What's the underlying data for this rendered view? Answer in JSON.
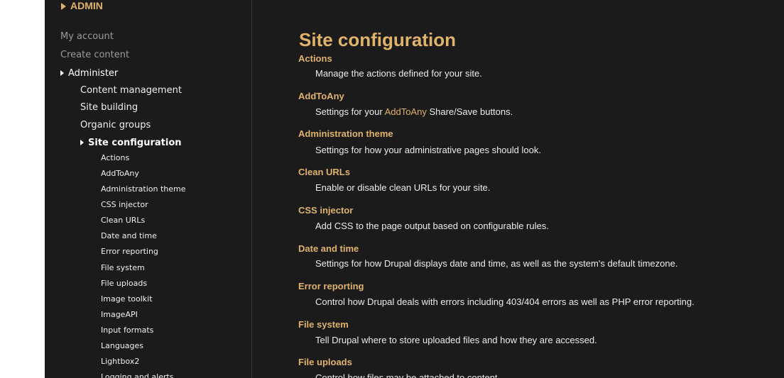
{
  "sidebar": {
    "section_title": "ADMIN",
    "top_items": [
      {
        "label": "My account"
      },
      {
        "label": "Create content"
      }
    ],
    "administer_label": "Administer",
    "admin_items": [
      {
        "label": "Content management"
      },
      {
        "label": "Site building"
      },
      {
        "label": "Organic groups"
      }
    ],
    "site_config_label": "Site configuration",
    "site_config_items": [
      {
        "label": "Actions"
      },
      {
        "label": "AddToAny"
      },
      {
        "label": "Administration theme"
      },
      {
        "label": "CSS injector"
      },
      {
        "label": "Clean URLs"
      },
      {
        "label": "Date and time"
      },
      {
        "label": "Error reporting"
      },
      {
        "label": "File system"
      },
      {
        "label": "File uploads"
      },
      {
        "label": "Image toolkit"
      },
      {
        "label": "ImageAPI"
      },
      {
        "label": "Input formats"
      },
      {
        "label": "Languages"
      },
      {
        "label": "Lightbox2"
      },
      {
        "label": "Logging and alerts"
      }
    ]
  },
  "main": {
    "page_title": "Site configuration",
    "entries": [
      {
        "title": "Actions",
        "desc": "Manage the actions defined for your site."
      },
      {
        "title": "AddToAny",
        "desc_pre": "Settings for your ",
        "desc_link": "AddToAny",
        "desc_post": " Share/Save buttons."
      },
      {
        "title": "Administration theme",
        "desc": "Settings for how your administrative pages should look."
      },
      {
        "title": "Clean URLs",
        "desc": "Enable or disable clean URLs for your site."
      },
      {
        "title": "CSS injector",
        "desc": "Add CSS to the page output based on configurable rules."
      },
      {
        "title": "Date and time",
        "desc": "Settings for how Drupal displays date and time, as well as the system's default timezone."
      },
      {
        "title": "Error reporting",
        "desc": "Control how Drupal deals with errors including 403/404 errors as well as PHP error reporting."
      },
      {
        "title": "File system",
        "desc": "Tell Drupal where to store uploaded files and how they are accessed."
      },
      {
        "title": "File uploads",
        "desc": "Control how files may be attached to content."
      }
    ]
  },
  "colors": {
    "background": "#1b1b1b",
    "accent": "#e0b36a",
    "text": "#ececec",
    "muted": "#9a9a9a"
  }
}
